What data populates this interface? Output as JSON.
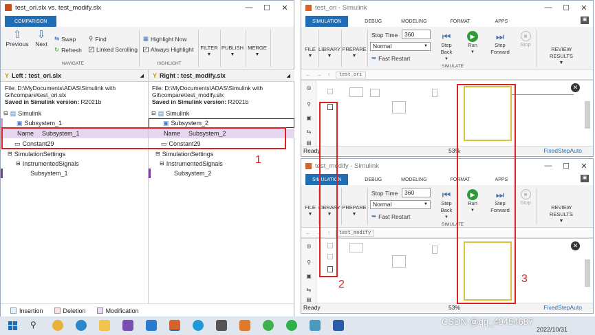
{
  "comparison_window": {
    "title": "test_ori.slx vs. test_modify.slx",
    "tab": "COMPARISON",
    "navigate": {
      "previous": "Previous",
      "next": "Next",
      "swap": "Swap",
      "refresh": "Refresh",
      "find": "Find",
      "linked_scrolling": "Linked Scrolling",
      "group": "NAVIGATE"
    },
    "highlight": {
      "highlight_now": "Highlight Now",
      "always_highlight": "Always Highlight",
      "group": "HIGHLIGHT"
    },
    "menus": [
      "FILTER",
      "PUBLISH",
      "MERGE"
    ],
    "left": {
      "header": "Left : test_ori.slx",
      "file_line1": "File: D:\\MyDocuments\\ADAS\\Simulink with",
      "file_line2": "Git\\compare\\test_ori.slx",
      "saved_label": "Saved in Simulink version:",
      "saved_value": "R2021b",
      "tree": {
        "root": "Simulink",
        "subsystem": "Subsystem_1",
        "name_key": "Name",
        "name_value": "Subsystem_1",
        "constant": "Constant29",
        "settings": "SimulationSettings",
        "signals": "InstrumentedSignals",
        "signal_item": "Subsystem_1"
      }
    },
    "right": {
      "header": "Right : test_modify.slx",
      "file_line1": "File: D:\\MyDocuments\\ADAS\\Simulink with",
      "file_line2": "Git\\compare\\test_modify.slx",
      "saved_label": "Saved in Simulink version:",
      "saved_value": "R2021b",
      "tree": {
        "root": "Simulink",
        "subsystem": "Subsystem_2",
        "name_key": "Name",
        "name_value": "Subsystem_2",
        "constant": "Constant29",
        "settings": "SimulationSettings",
        "signals": "InstrumentedSignals",
        "signal_item": "Subsystem_2"
      }
    },
    "legend": {
      "insertion": "Insertion",
      "deletion": "Deletion",
      "modification": "Modification"
    }
  },
  "sim_ori": {
    "title": "test_ori - Simulink",
    "breadcrumb": "test_ori",
    "status_left": "Ready",
    "zoom": "53%",
    "solver": "FixedStepAuto"
  },
  "sim_modify": {
    "title": "test_modify - Simulink",
    "breadcrumb": "test_modify",
    "status_left": "Ready",
    "zoom": "53%",
    "solver": "FixedStepAuto"
  },
  "sim_ribbon": {
    "tabs": [
      "SIMULATION",
      "DEBUG",
      "MODELING",
      "FORMAT",
      "APPS"
    ],
    "file": "FILE",
    "library": "LIBRARY",
    "prepare": "PREPARE",
    "stop_time_label": "Stop Time",
    "stop_time_value": "360",
    "mode": "Normal",
    "fast_restart": "Fast Restart",
    "step_back": "Step Back",
    "run": "Run",
    "step_forward": "Step Forward",
    "stop": "Stop",
    "review": "REVIEW RESULTS",
    "group": "SIMULATE"
  },
  "annotations": {
    "one": "1",
    "two": "2",
    "three": "3"
  },
  "taskbar": {
    "watermark": "CSDN @qq_40454687",
    "date": "2022/10/31"
  },
  "colors": {
    "insertion": "#4fb0e8",
    "deletion": "#f0a0a0",
    "modification": "#c79be0",
    "highlight_row": "#e6d6ef",
    "accent": "#1f6db5",
    "red_annotation": "#e02020"
  }
}
